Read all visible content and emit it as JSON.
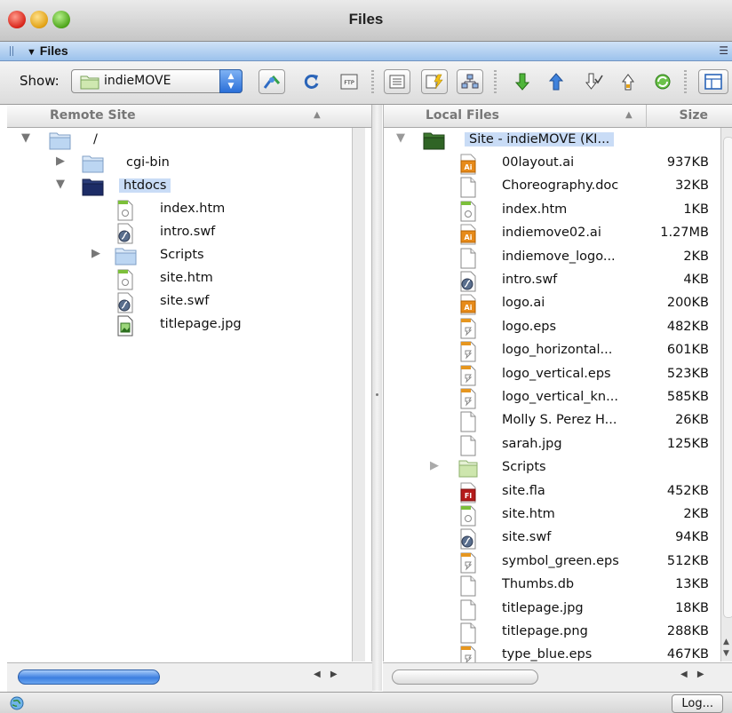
{
  "window": {
    "title": "Files"
  },
  "panel": {
    "title": "Files"
  },
  "toolbar": {
    "show_label": "Show:",
    "site_selector": {
      "value": "indieMOVE"
    },
    "buttons": [
      {
        "icon": "connect-icon"
      },
      {
        "icon": "refresh-icon"
      },
      {
        "icon": "ftp-log-icon",
        "text": "FTP"
      },
      {
        "icon": "remote-view-icon"
      },
      {
        "icon": "testing-server-icon"
      },
      {
        "icon": "repository-icon"
      },
      {
        "icon": "get-files-icon"
      },
      {
        "icon": "put-files-icon"
      },
      {
        "icon": "check-out-icon"
      },
      {
        "icon": "check-in-icon"
      },
      {
        "icon": "synchronize-icon"
      },
      {
        "icon": "expand-panel-icon"
      }
    ]
  },
  "remote": {
    "column_header": "Remote Site",
    "items": [
      {
        "name": "/",
        "icon": "folder-icon",
        "expanded": true
      },
      {
        "name": "cgi-bin",
        "icon": "folder-icon",
        "expanded": false
      },
      {
        "name": "htdocs",
        "icon": "site-folder-icon",
        "expanded": true,
        "selected": true
      },
      {
        "name": "index.htm",
        "icon": "html-file-icon"
      },
      {
        "name": "intro.swf",
        "icon": "swf-file-icon"
      },
      {
        "name": "Scripts",
        "icon": "folder-icon",
        "expanded": false
      },
      {
        "name": "site.htm",
        "icon": "html-file-icon"
      },
      {
        "name": "site.swf",
        "icon": "swf-file-icon"
      },
      {
        "name": "titlepage.jpg",
        "icon": "image-file-icon"
      }
    ]
  },
  "local": {
    "column_header": "Local Files",
    "size_header": "Size",
    "root": {
      "name": "Site - indieMOVE (KI...",
      "icon": "site-folder-icon"
    },
    "files": [
      {
        "name": "00layout.ai",
        "size": "937KB",
        "icon": "illustrator-file-icon"
      },
      {
        "name": "Choreography.doc",
        "size": "32KB",
        "icon": "generic-file-icon"
      },
      {
        "name": "index.htm",
        "size": "1KB",
        "icon": "html-file-icon"
      },
      {
        "name": "indiemove02.ai",
        "size": "1.27MB",
        "icon": "illustrator-file-icon"
      },
      {
        "name": "indiemove_logo...",
        "size": "2KB",
        "icon": "generic-file-icon"
      },
      {
        "name": "intro.swf",
        "size": "4KB",
        "icon": "swf-file-icon"
      },
      {
        "name": "logo.ai",
        "size": "200KB",
        "icon": "illustrator-file-icon"
      },
      {
        "name": "logo.eps",
        "size": "482KB",
        "icon": "eps-file-icon"
      },
      {
        "name": "logo_horizontal...",
        "size": "601KB",
        "icon": "eps-file-icon"
      },
      {
        "name": "logo_vertical.eps",
        "size": "523KB",
        "icon": "eps-file-icon"
      },
      {
        "name": "logo_vertical_kn...",
        "size": "585KB",
        "icon": "eps-file-icon"
      },
      {
        "name": "Molly S. Perez H...",
        "size": "26KB",
        "icon": "generic-file-icon"
      },
      {
        "name": "sarah.jpg",
        "size": "125KB",
        "icon": "generic-file-icon"
      },
      {
        "name": "Scripts",
        "size": "",
        "icon": "folder-icon",
        "folder": true
      },
      {
        "name": "site.fla",
        "size": "452KB",
        "icon": "flash-file-icon"
      },
      {
        "name": "site.htm",
        "size": "2KB",
        "icon": "html-file-icon"
      },
      {
        "name": "site.swf",
        "size": "94KB",
        "icon": "swf-file-icon"
      },
      {
        "name": "symbol_green.eps",
        "size": "512KB",
        "icon": "eps-file-icon"
      },
      {
        "name": "Thumbs.db",
        "size": "13KB",
        "icon": "generic-file-icon"
      },
      {
        "name": "titlepage.jpg",
        "size": "18KB",
        "icon": "generic-file-icon"
      },
      {
        "name": "titlepage.png",
        "size": "288KB",
        "icon": "generic-file-icon"
      },
      {
        "name": "type_blue.eps",
        "size": "467KB",
        "icon": "eps-file-icon"
      }
    ]
  },
  "status": {
    "log_button": "Log..."
  },
  "colors": {
    "selection": "#c9dcf6",
    "panel_header": "#9cc2ec",
    "scroll_thumb": "#3d7fe0"
  }
}
